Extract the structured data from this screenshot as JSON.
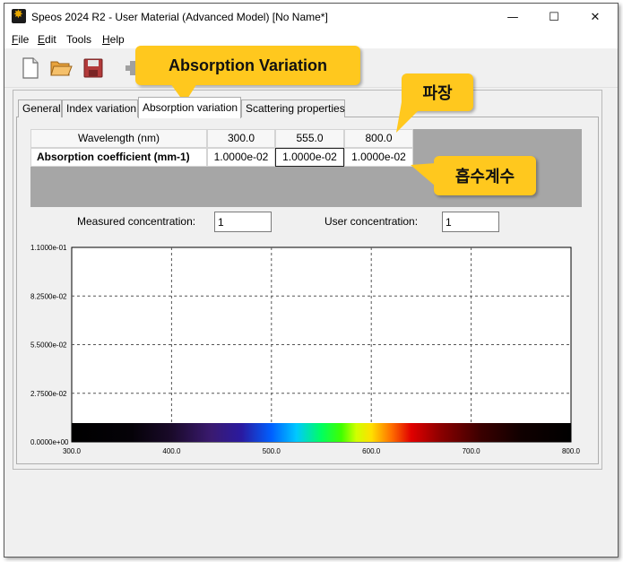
{
  "window": {
    "title": "Speos 2024 R2 - User Material (Advanced Model) [No Name*]",
    "controls": {
      "minimize": "—",
      "maximize": "☐",
      "close": "✕"
    }
  },
  "menu": [
    {
      "label": "File",
      "mnemonic": "F",
      "rest": "ile"
    },
    {
      "label": "Edit",
      "mnemonic": "E",
      "rest": "dit"
    },
    {
      "label": "Tools",
      "mnemonic": "",
      "rest": "Tools"
    },
    {
      "label": "Help",
      "mnemonic": "H",
      "rest": "elp"
    }
  ],
  "toolbar": {
    "buttons": [
      "new-file-icon",
      "open-folder-icon",
      "save-icon",
      "add-icon"
    ]
  },
  "tabs": [
    {
      "label": "General",
      "active": false
    },
    {
      "label": "Index variation",
      "active": false
    },
    {
      "label": "Absorption variation",
      "active": true
    },
    {
      "label": "Scattering properties",
      "active": false
    }
  ],
  "grid": {
    "wavelength_label": "Wavelength (nm)",
    "absorption_label": "Absorption coefficient (mm-1)",
    "wavelengths": [
      "300.0",
      "555.0",
      "800.0"
    ],
    "coefficients": [
      "1.0000e-02",
      "1.0000e-02",
      "1.0000e-02"
    ]
  },
  "concentration": {
    "measured_label": "Measured concentration:",
    "measured_value": "1",
    "user_label": "User concentration:",
    "user_value": "1"
  },
  "chart_data": {
    "type": "line",
    "x": [
      300,
      555,
      800
    ],
    "values": [
      0.01,
      0.01,
      0.01
    ],
    "xlim": [
      300,
      800
    ],
    "ylim": [
      0,
      0.11
    ],
    "x_ticks": [
      "300.0",
      "400.0",
      "500.0",
      "600.0",
      "700.0",
      "800.0"
    ],
    "y_ticks": [
      "0.0000e+00",
      "2.7500e-02",
      "5.5000e-02",
      "8.2500e-02",
      "1.1000e-01"
    ],
    "grid": true,
    "spectrum_band": true
  },
  "callouts": {
    "main": "Absorption Variation",
    "wavelength": "파장",
    "absorption": "흡수계수"
  },
  "colors": {
    "callout": "#ffc81e",
    "grid_background": "#a6a6a6"
  }
}
